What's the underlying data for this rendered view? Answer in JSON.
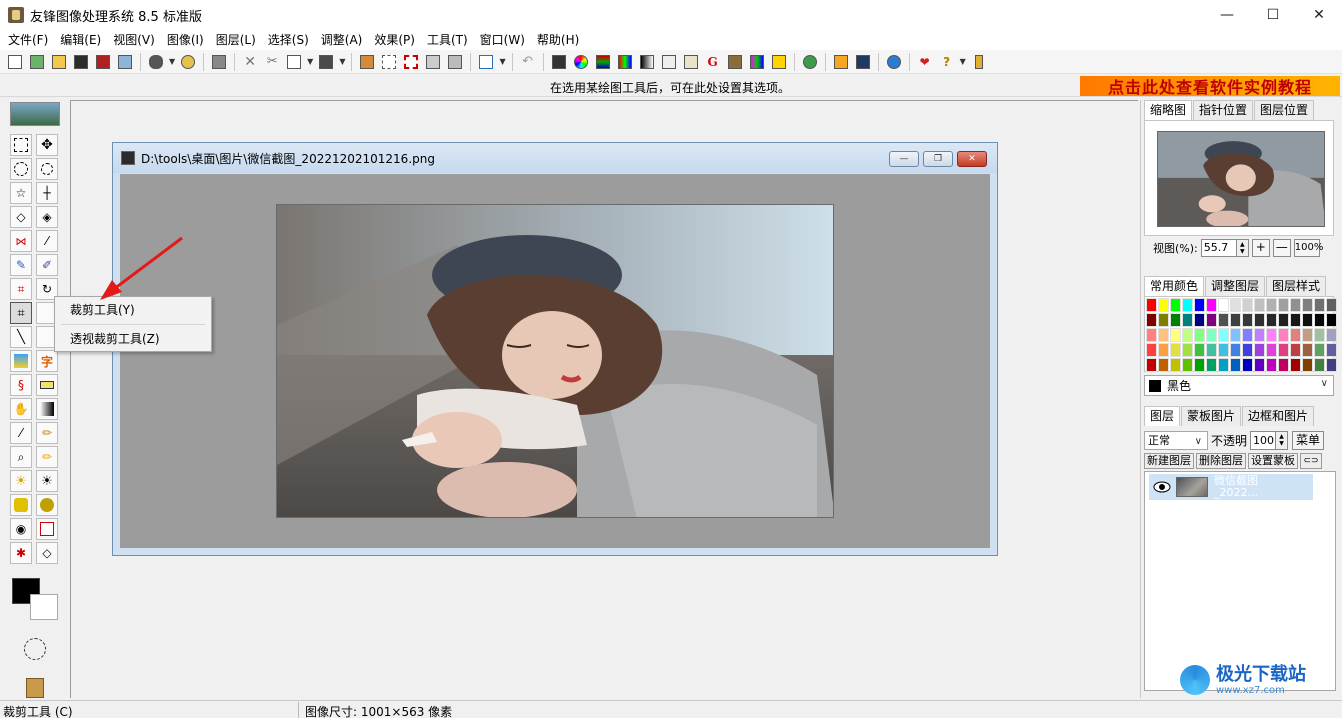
{
  "app": {
    "title": "友锋图像处理系统 8.5 标准版"
  },
  "window_controls": {
    "minimize": "—",
    "maximize": "☐",
    "close": "✕"
  },
  "menu": [
    "文件(F)",
    "编辑(E)",
    "视图(V)",
    "图像(I)",
    "图层(L)",
    "选择(S)",
    "调整(A)",
    "效果(P)",
    "工具(T)",
    "窗口(W)",
    "帮助(H)"
  ],
  "option_bar": {
    "hint": "在选用某绘图工具后，可在此处设置其选项。",
    "promo": "点击此处查看软件实例教程"
  },
  "image_window": {
    "title": "D:\\tools\\桌面\\图片\\微信截图_20221202101216.png",
    "controls": {
      "minimize": "—",
      "restore": "❐",
      "close": "✕"
    }
  },
  "context_menu": {
    "items": [
      "裁剪工具(Y)",
      "透视裁剪工具(Z)"
    ]
  },
  "right_panel": {
    "top_tabs": [
      "缩略图",
      "指针位置",
      "图层位置"
    ],
    "zoom": {
      "label": "视图(%):",
      "value": "55.7",
      "plus": "+",
      "minus": "—",
      "hundred": "100%"
    },
    "color_tabs": [
      "常用颜色",
      "调整图层",
      "图层样式"
    ],
    "color_select": "黑色",
    "layer_tabs": [
      "图层",
      "蒙板图片",
      "边框和图片"
    ],
    "blend_mode": "正常",
    "opacity_label": "不透明",
    "opacity_value": "100",
    "menu_button": "菜单",
    "layer_buttons": [
      "新建图层",
      "删除图层",
      "设置蒙板"
    ],
    "layers": [
      {
        "name": "微信截图",
        "sub": "_2022..."
      }
    ]
  },
  "palette_colors": [
    "#ff0000",
    "#ffff00",
    "#00ff00",
    "#00ffff",
    "#0000ff",
    "#ff00ff",
    "#ffffff",
    "#e0e0e0",
    "#d0d0d0",
    "#c0c0c0",
    "#b0b0b0",
    "#a0a0a0",
    "#909090",
    "#808080",
    "#707070",
    "#606060",
    "#800000",
    "#808000",
    "#008000",
    "#008080",
    "#000080",
    "#800080",
    "#505050",
    "#404040",
    "#383838",
    "#303030",
    "#282828",
    "#202020",
    "#181818",
    "#101010",
    "#080808",
    "#000000",
    "#ff8080",
    "#ffc080",
    "#ffff80",
    "#c0ff80",
    "#80ff80",
    "#80ffc0",
    "#80ffff",
    "#80c0ff",
    "#8080ff",
    "#c080ff",
    "#ff80ff",
    "#ff80c0",
    "#e08080",
    "#c0a080",
    "#a0c0a0",
    "#a0a0c0",
    "#ff4040",
    "#ffa040",
    "#e0e040",
    "#a0e040",
    "#40c040",
    "#40c0a0",
    "#40c0e0",
    "#4080e0",
    "#4040e0",
    "#a040e0",
    "#e040e0",
    "#e04080",
    "#c04040",
    "#a06040",
    "#60a060",
    "#6060a0",
    "#c00000",
    "#c06000",
    "#c0c000",
    "#60c000",
    "#00a000",
    "#00a060",
    "#00a0c0",
    "#0060c0",
    "#0000c0",
    "#6000c0",
    "#c000c0",
    "#c00060",
    "#a00000",
    "#804000",
    "#408040",
    "#404080"
  ],
  "statusbar": {
    "tool": "裁剪工具 (C)",
    "size": "图像尺寸: 1001×563 像素"
  },
  "watermark": {
    "title": "极光下载站",
    "url": "www.xz7.com"
  },
  "colors": {
    "foreground": "#000000",
    "background": "#ffffff",
    "layer_selected": "#cfe3f7",
    "arrow": "#e21a1a"
  }
}
